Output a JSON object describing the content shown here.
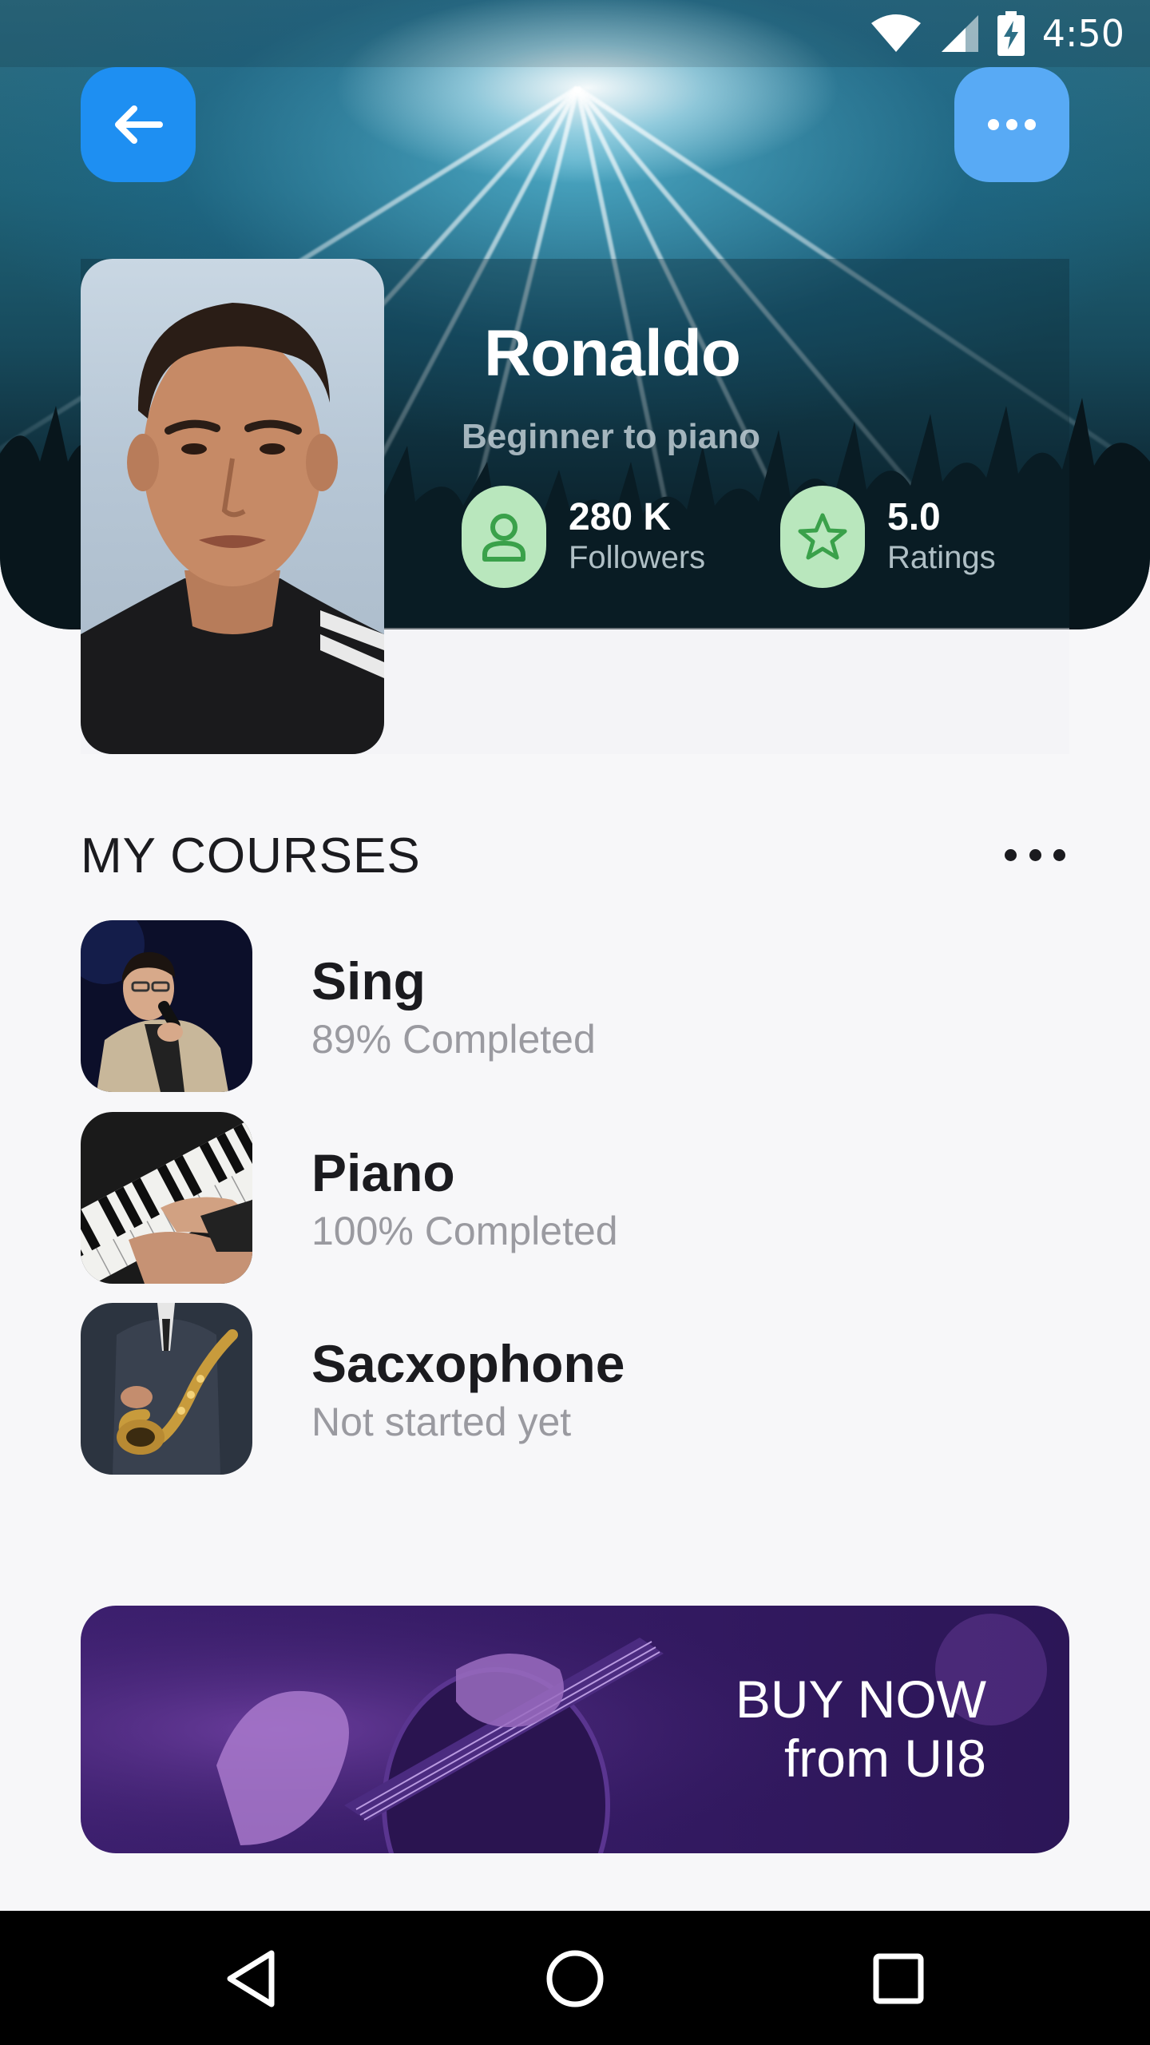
{
  "status_bar": {
    "time": "4:50",
    "icons": [
      "wifi-icon",
      "signal-icon",
      "battery-charging-icon"
    ]
  },
  "header": {
    "back_icon": "arrow-left-icon",
    "more_icon": "more-horizontal-icon",
    "back_color": "#1e8ff2",
    "more_color": "#58aaf5"
  },
  "profile": {
    "name": "Ronaldo",
    "subtitle": "Beginner to piano",
    "stats": [
      {
        "icon": "user-icon",
        "value": "280 K",
        "label": "Followers"
      },
      {
        "icon": "star-icon",
        "value": "5.0",
        "label": "Ratings"
      }
    ],
    "stat_icon_bg": "#b9e7bd",
    "stat_icon_color": "#3aa14a"
  },
  "courses": {
    "title": "MY COURSES",
    "more_icon": "more-horizontal-icon",
    "items": [
      {
        "title": "Sing",
        "status": "89% Completed",
        "thumb": "singer-image"
      },
      {
        "title": "Piano",
        "status": "100% Completed",
        "thumb": "piano-image"
      },
      {
        "title": "Sacxophone",
        "status": "Not started yet",
        "thumb": "saxophone-image"
      }
    ]
  },
  "banner": {
    "line1": "BUY NOW",
    "line2": "from UI8",
    "color": "#341a63"
  },
  "nav_bar": {
    "icons": [
      "back-triangle-icon",
      "home-circle-icon",
      "recents-square-icon"
    ]
  }
}
